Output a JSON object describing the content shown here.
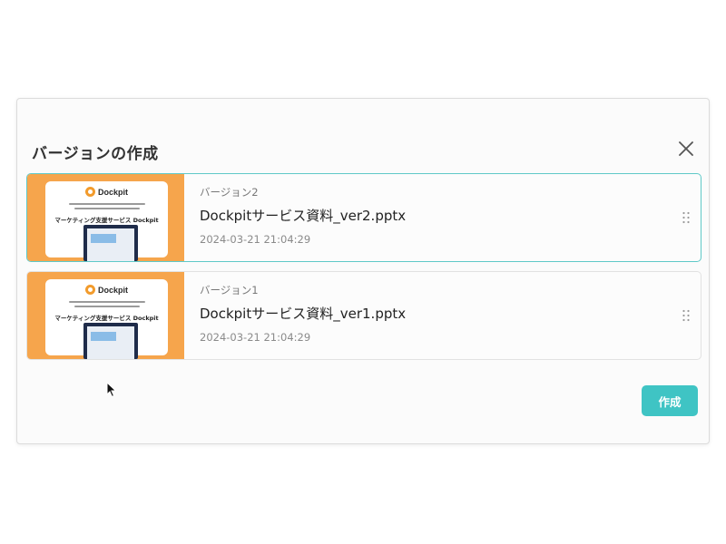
{
  "dialog": {
    "title": "バージョンの作成",
    "create_label": "作成",
    "close_icon": "close-icon"
  },
  "versions": [
    {
      "label": "バージョン2",
      "file_name": "Dockpitサービス資料_ver2.pptx",
      "timestamp": "2024-03-21 21:04:29",
      "selected": true,
      "thumbnail": {
        "logo_text": "Dockpit",
        "headline": "マーケティング支援サービス Dockpit"
      }
    },
    {
      "label": "バージョン1",
      "file_name": "Dockpitサービス資料_ver1.pptx",
      "timestamp": "2024-03-21 21:04:29",
      "selected": false,
      "thumbnail": {
        "logo_text": "Dockpit",
        "headline": "マーケティング支援サービス Dockpit"
      }
    }
  ],
  "colors": {
    "accent": "#3fc4c4",
    "selected_border": "#5fc9c8",
    "thumbnail_bg": "#f6a54c"
  }
}
